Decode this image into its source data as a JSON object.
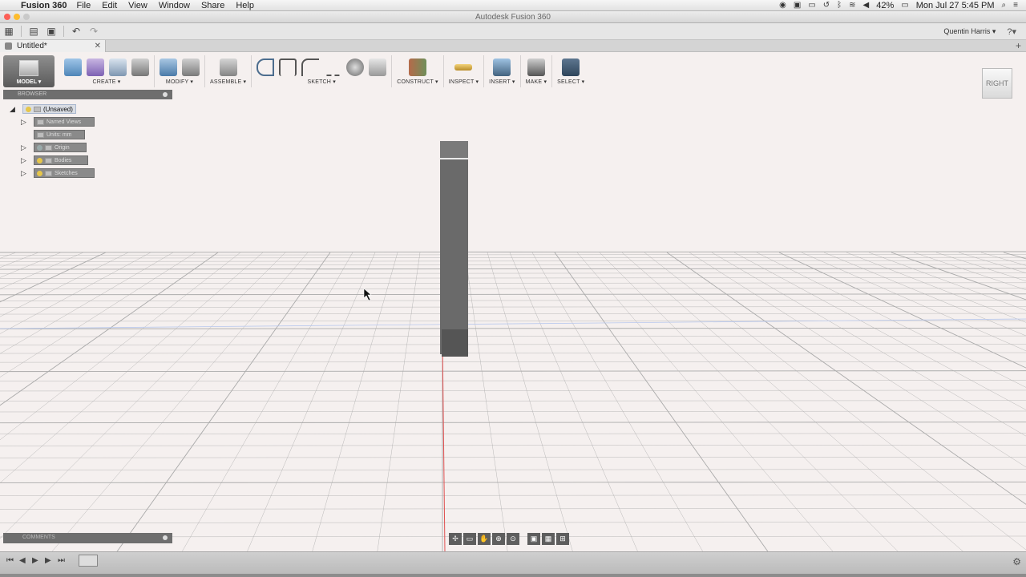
{
  "menubar": {
    "app_name": "Fusion 360",
    "items": [
      "File",
      "Edit",
      "View",
      "Window",
      "Share",
      "Help"
    ],
    "battery": "42%",
    "datetime": "Mon Jul 27  5:45 PM"
  },
  "window": {
    "title": "Autodesk Fusion 360"
  },
  "appbar": {
    "user": "Quentin Harris ▾",
    "help": "?▾"
  },
  "tab": {
    "title": "Untitled*",
    "close": "✕",
    "add": "+"
  },
  "toolbar": {
    "workspace": "MODEL ▾",
    "groups": [
      {
        "label": "CREATE ▾"
      },
      {
        "label": "MODIFY ▾"
      },
      {
        "label": "ASSEMBLE ▾"
      },
      {
        "label": "SKETCH ▾"
      },
      {
        "label": "CONSTRUCT ▾"
      },
      {
        "label": "INSPECT ▾"
      },
      {
        "label": "INSERT ▾"
      },
      {
        "label": "MAKE ▾"
      },
      {
        "label": "SELECT ▾"
      }
    ]
  },
  "viewcube": {
    "label": "RIGHT"
  },
  "browser": {
    "header": "BROWSER",
    "root": "(Unsaved)",
    "nodes": [
      {
        "label": "Named Views"
      },
      {
        "label": "Units: mm"
      },
      {
        "label": "Origin"
      },
      {
        "label": "Bodies"
      },
      {
        "label": "Sketches"
      }
    ]
  },
  "comments": {
    "label": "COMMENTS"
  },
  "colors": {
    "grid": "#aaaaaa",
    "axis_red": "#e05050",
    "body": "#6a6a6a"
  }
}
